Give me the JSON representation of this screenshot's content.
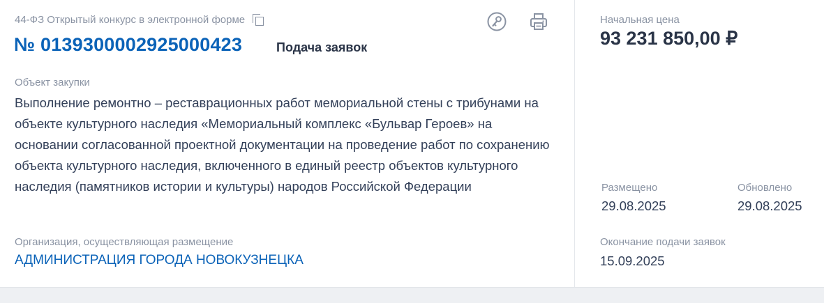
{
  "header": {
    "procurement_type": "44-ФЗ Открытый конкурс в электронной форме",
    "number": "№ 0139300002925000423",
    "status": "Подача заявок"
  },
  "object": {
    "label": "Объект закупки",
    "description": "Выполнение ремонтно – реставрационных работ мемориальной стены с трибунами на объекте культурного наследия «Мемориальный комплекс «Бульвар Героев» на основании согласованной проектной документации на проведение работ по сохранению объекта культурного наследия, включенного в единый реестр объектов культурного наследия (памятников истории и культуры) народов Российской Федерации"
  },
  "organization": {
    "label": "Организация, осуществляющая размещение",
    "name": "АДМИНИСТРАЦИЯ ГОРОДА НОВОКУЗНЕЦКА"
  },
  "side": {
    "price_label": "Начальная цена",
    "price": "93 231 850,00 ₽",
    "posted_label": "Размещено",
    "posted": "29.08.2025",
    "updated_label": "Обновлено",
    "updated": "29.08.2025",
    "deadline_label": "Окончание подачи заявок",
    "deadline": "15.09.2025"
  },
  "icons": {
    "copy": "copy-icon",
    "key": "key-icon",
    "print": "printer-icon",
    "color": "#8a93a3"
  },
  "colors": {
    "link": "#0b63b8",
    "text": "#334059",
    "muted": "#8a93a3"
  }
}
